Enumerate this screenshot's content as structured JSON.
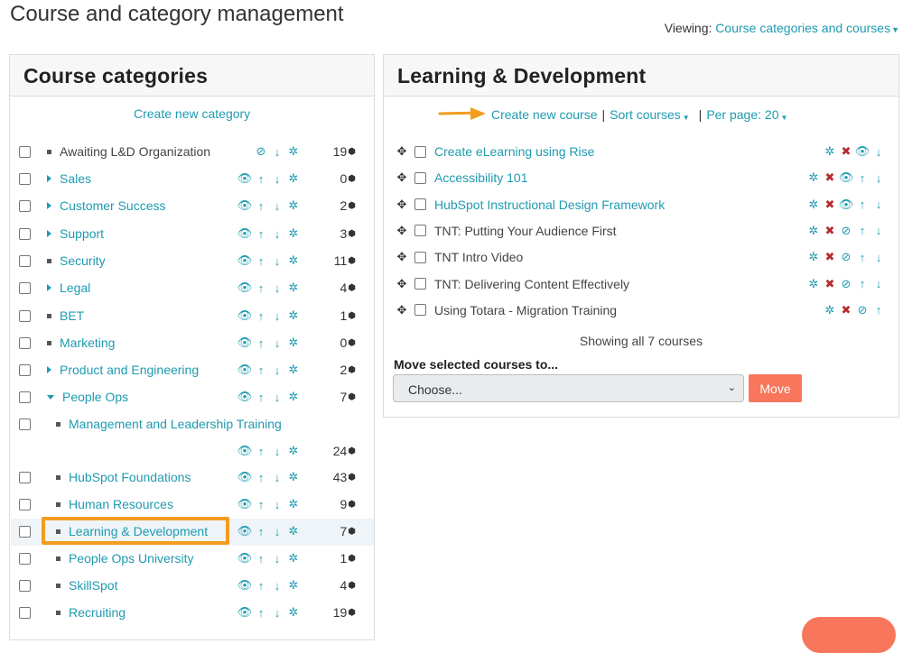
{
  "page": {
    "title": "Course and category management",
    "viewing_label": "Viewing:",
    "viewing_value": "Course categories and courses"
  },
  "categories_panel": {
    "heading": "Course categories",
    "create_link": "Create new category",
    "items": [
      {
        "name": "Awaiting L&D Organization",
        "count": "19",
        "level": 0,
        "marker": "bullet",
        "style": "plain",
        "icons": [
          "eye-slash",
          "arrow-down",
          "gear"
        ]
      },
      {
        "name": "Sales",
        "count": "0",
        "level": 0,
        "marker": "collapsed",
        "style": "link",
        "icons": [
          "eye",
          "arrow-up",
          "arrow-down",
          "gear"
        ]
      },
      {
        "name": "Customer Success",
        "count": "2",
        "level": 0,
        "marker": "collapsed",
        "style": "link",
        "icons": [
          "eye",
          "arrow-up",
          "arrow-down",
          "gear"
        ]
      },
      {
        "name": "Support",
        "count": "3",
        "level": 0,
        "marker": "collapsed",
        "style": "link",
        "icons": [
          "eye",
          "arrow-up",
          "arrow-down",
          "gear"
        ]
      },
      {
        "name": "Security",
        "count": "11",
        "level": 0,
        "marker": "bullet",
        "style": "link",
        "icons": [
          "eye",
          "arrow-up",
          "arrow-down",
          "gear"
        ]
      },
      {
        "name": "Legal",
        "count": "4",
        "level": 0,
        "marker": "collapsed",
        "style": "link",
        "icons": [
          "eye",
          "arrow-up",
          "arrow-down",
          "gear"
        ]
      },
      {
        "name": "BET",
        "count": "1",
        "level": 0,
        "marker": "bullet",
        "style": "link",
        "icons": [
          "eye",
          "arrow-up",
          "arrow-down",
          "gear"
        ]
      },
      {
        "name": "Marketing",
        "count": "0",
        "level": 0,
        "marker": "bullet",
        "style": "link",
        "icons": [
          "eye",
          "arrow-up",
          "arrow-down",
          "gear"
        ]
      },
      {
        "name": "Product and Engineering",
        "count": "2",
        "level": 0,
        "marker": "collapsed",
        "style": "link",
        "icons": [
          "eye",
          "arrow-up",
          "arrow-down",
          "gear"
        ]
      },
      {
        "name": "People Ops",
        "count": "7",
        "level": 0,
        "marker": "expanded",
        "style": "link",
        "icons": [
          "eye",
          "arrow-up",
          "arrow-down",
          "gear"
        ]
      },
      {
        "name": "Management and Leadership Training",
        "count": "24",
        "level": 1,
        "marker": "bullet",
        "style": "link",
        "icons": [
          "eye",
          "arrow-up",
          "arrow-down",
          "gear"
        ],
        "wrapped": true
      },
      {
        "name": "HubSpot Foundations",
        "count": "43",
        "level": 1,
        "marker": "bullet",
        "style": "link",
        "icons": [
          "eye",
          "arrow-up",
          "arrow-down",
          "gear"
        ]
      },
      {
        "name": "Human Resources",
        "count": "9",
        "level": 1,
        "marker": "bullet",
        "style": "link",
        "icons": [
          "eye",
          "arrow-up",
          "arrow-down",
          "gear"
        ]
      },
      {
        "name": "Learning & Development",
        "count": "7",
        "level": 1,
        "marker": "bullet",
        "style": "link",
        "icons": [
          "eye",
          "arrow-up",
          "arrow-down",
          "gear"
        ],
        "selected": true
      },
      {
        "name": "People Ops University",
        "count": "1",
        "level": 1,
        "marker": "bullet",
        "style": "link",
        "icons": [
          "eye",
          "arrow-up",
          "arrow-down",
          "gear"
        ]
      },
      {
        "name": "SkillSpot",
        "count": "4",
        "level": 1,
        "marker": "bullet",
        "style": "link",
        "icons": [
          "eye",
          "arrow-up",
          "arrow-down",
          "gear"
        ]
      },
      {
        "name": "Recruiting",
        "count": "19",
        "level": 1,
        "marker": "bullet",
        "style": "link",
        "icons": [
          "eye",
          "arrow-up",
          "arrow-down",
          "gear"
        ]
      }
    ]
  },
  "courses_panel": {
    "heading": "Learning & Development",
    "create_course": "Create new course",
    "separator": "|",
    "sort_courses": "Sort courses",
    "per_page": "Per page: 20",
    "courses": [
      {
        "name": "Create eLearning using Rise",
        "style": "link",
        "icons": [
          "gear",
          "delete",
          "eye",
          "arrow-down"
        ]
      },
      {
        "name": "Accessibility 101",
        "style": "link",
        "icons": [
          "gear",
          "delete",
          "eye",
          "arrow-up",
          "arrow-down"
        ]
      },
      {
        "name": "HubSpot Instructional Design Framework",
        "style": "link",
        "icons": [
          "gear",
          "delete",
          "eye",
          "arrow-up",
          "arrow-down"
        ]
      },
      {
        "name": "TNT: Putting Your Audience First",
        "style": "plain",
        "icons": [
          "gear",
          "delete",
          "eye-slash",
          "arrow-up",
          "arrow-down"
        ]
      },
      {
        "name": "TNT Intro Video",
        "style": "plain",
        "icons": [
          "gear",
          "delete",
          "eye-slash",
          "arrow-up",
          "arrow-down"
        ]
      },
      {
        "name": "TNT: Delivering Content Effectively",
        "style": "plain",
        "icons": [
          "gear",
          "delete",
          "eye-slash",
          "arrow-up",
          "arrow-down"
        ]
      },
      {
        "name": "Using Totara - Migration Training",
        "style": "plain",
        "icons": [
          "gear",
          "delete",
          "eye-slash",
          "arrow-up"
        ]
      }
    ],
    "showing": "Showing all 7 courses",
    "move_label": "Move selected courses to...",
    "move_select": "Choose...",
    "move_button": "Move"
  },
  "colors": {
    "link": "#1e9bb0",
    "accent_button": "#f7765c",
    "highlight_box": "#f39c1f",
    "delete_icon": "#b32d2e"
  }
}
